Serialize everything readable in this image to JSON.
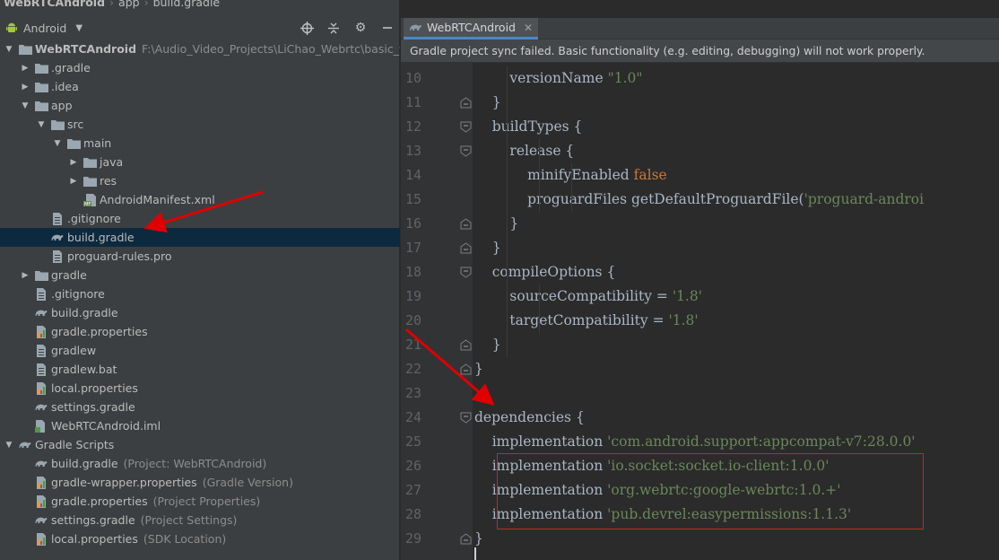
{
  "breadcrumb": [
    "WebRTCAndroid",
    "app",
    "build.gradle"
  ],
  "project_toolbar": {
    "view_label": "Android",
    "icons": [
      "locate-icon",
      "collapse-all-icon",
      "gear-icon",
      "minimize-icon"
    ]
  },
  "tree": [
    {
      "indent": 0,
      "arrow": "down",
      "icon": "project-folder",
      "label": "WebRTCAndroid",
      "bold": true,
      "hint": "F:\\Audio_Video_Projects\\LiChao_Webrtc\\basic_webrt"
    },
    {
      "indent": 1,
      "arrow": "right",
      "icon": "folder",
      "label": ".gradle"
    },
    {
      "indent": 1,
      "arrow": "right",
      "icon": "folder",
      "label": ".idea"
    },
    {
      "indent": 1,
      "arrow": "down",
      "icon": "folder",
      "label": "app"
    },
    {
      "indent": 2,
      "arrow": "down",
      "icon": "folder",
      "label": "src"
    },
    {
      "indent": 3,
      "arrow": "down",
      "icon": "folder",
      "label": "main"
    },
    {
      "indent": 4,
      "arrow": "right",
      "icon": "folder",
      "label": "java"
    },
    {
      "indent": 4,
      "arrow": "right",
      "icon": "folder",
      "label": "res"
    },
    {
      "indent": 4,
      "arrow": "none",
      "icon": "manifest",
      "label": "AndroidManifest.xml"
    },
    {
      "indent": 2,
      "arrow": "none",
      "icon": "file",
      "label": ".gitignore"
    },
    {
      "indent": 2,
      "arrow": "none",
      "icon": "gradle",
      "label": "build.gradle",
      "selected": true
    },
    {
      "indent": 2,
      "arrow": "none",
      "icon": "file",
      "label": "proguard-rules.pro"
    },
    {
      "indent": 1,
      "arrow": "right",
      "icon": "folder",
      "label": "gradle"
    },
    {
      "indent": 1,
      "arrow": "none",
      "icon": "file",
      "label": ".gitignore"
    },
    {
      "indent": 1,
      "arrow": "none",
      "icon": "gradle",
      "label": "build.gradle"
    },
    {
      "indent": 1,
      "arrow": "none",
      "icon": "properties",
      "label": "gradle.properties"
    },
    {
      "indent": 1,
      "arrow": "none",
      "icon": "file",
      "label": "gradlew"
    },
    {
      "indent": 1,
      "arrow": "none",
      "icon": "file",
      "label": "gradlew.bat"
    },
    {
      "indent": 1,
      "arrow": "none",
      "icon": "properties",
      "label": "local.properties"
    },
    {
      "indent": 1,
      "arrow": "none",
      "icon": "gradle",
      "label": "settings.gradle"
    },
    {
      "indent": 1,
      "arrow": "none",
      "icon": "iml",
      "label": "WebRTCAndroid.iml"
    },
    {
      "indent": 0,
      "arrow": "down",
      "icon": "gradle",
      "label": "Gradle Scripts"
    },
    {
      "indent": 1,
      "arrow": "none",
      "icon": "gradle",
      "label": "build.gradle",
      "hint": "(Project: WebRTCAndroid)"
    },
    {
      "indent": 1,
      "arrow": "none",
      "icon": "properties",
      "label": "gradle-wrapper.properties",
      "hint": "(Gradle Version)"
    },
    {
      "indent": 1,
      "arrow": "none",
      "icon": "properties",
      "label": "gradle.properties",
      "hint": "(Project Properties)"
    },
    {
      "indent": 1,
      "arrow": "none",
      "icon": "gradle",
      "label": "settings.gradle",
      "hint": "(Project Settings)"
    },
    {
      "indent": 1,
      "arrow": "none",
      "icon": "properties",
      "label": "local.properties",
      "hint": "(SDK Location)"
    }
  ],
  "editor": {
    "tab_label": "WebRTCAndroid",
    "sync_message": "Gradle project sync failed. Basic functionality (e.g. editing, debugging) will not work properly.",
    "lines": [
      {
        "num": "10",
        "fold": "none",
        "segs": [
          [
            "        versionName ",
            "p"
          ],
          [
            "\"1.0\"",
            "s"
          ]
        ]
      },
      {
        "num": "11",
        "fold": "end",
        "segs": [
          [
            "    }",
            "p"
          ]
        ]
      },
      {
        "num": "12",
        "fold": "start",
        "segs": [
          [
            "    buildTypes {",
            "p"
          ]
        ]
      },
      {
        "num": "13",
        "fold": "start",
        "segs": [
          [
            "        release {",
            "p"
          ]
        ]
      },
      {
        "num": "14",
        "fold": "none",
        "segs": [
          [
            "            minifyEnabled ",
            "p"
          ],
          [
            "false",
            "k"
          ]
        ]
      },
      {
        "num": "15",
        "fold": "none",
        "segs": [
          [
            "            proguardFiles getDefaultProguardFile(",
            "p"
          ],
          [
            "'proguard-androi",
            "s"
          ]
        ]
      },
      {
        "num": "16",
        "fold": "end",
        "segs": [
          [
            "        }",
            "p"
          ]
        ]
      },
      {
        "num": "17",
        "fold": "end",
        "segs": [
          [
            "    }",
            "p"
          ]
        ]
      },
      {
        "num": "18",
        "fold": "start",
        "segs": [
          [
            "    compileOptions {",
            "p"
          ]
        ]
      },
      {
        "num": "19",
        "fold": "none",
        "segs": [
          [
            "        sourceCompatibility = ",
            "p"
          ],
          [
            "'1.8'",
            "s"
          ]
        ]
      },
      {
        "num": "20",
        "fold": "none",
        "segs": [
          [
            "        targetCompatibility = ",
            "p"
          ],
          [
            "'1.8'",
            "s"
          ]
        ]
      },
      {
        "num": "21",
        "fold": "end",
        "segs": [
          [
            "    }",
            "p"
          ]
        ]
      },
      {
        "num": "22",
        "fold": "end",
        "segs": [
          [
            "}",
            "p"
          ]
        ]
      },
      {
        "num": "23",
        "fold": "none",
        "segs": []
      },
      {
        "num": "24",
        "fold": "start",
        "segs": [
          [
            "dependencies {",
            "p"
          ]
        ]
      },
      {
        "num": "25",
        "fold": "none",
        "segs": [
          [
            "    implementation ",
            "p"
          ],
          [
            "'com.android.support:appcompat-v7:28.0.0'",
            "s"
          ]
        ]
      },
      {
        "num": "26",
        "fold": "none",
        "segs": [
          [
            "    implementation ",
            "p"
          ],
          [
            "'io.socket:socket.io-client:1.0.0'",
            "s"
          ]
        ]
      },
      {
        "num": "27",
        "fold": "none",
        "segs": [
          [
            "    implementation ",
            "p"
          ],
          [
            "'org.webrtc:google-webrtc:1.0.+'",
            "s"
          ]
        ]
      },
      {
        "num": "28",
        "fold": "none",
        "segs": [
          [
            "    implementation ",
            "p"
          ],
          [
            "'pub.devrel:easypermissions:1.1.3'",
            "s"
          ]
        ]
      },
      {
        "num": "29",
        "fold": "end",
        "segs": [
          [
            "}",
            "p"
          ]
        ]
      },
      {
        "num": "",
        "fold": "none",
        "segs": []
      }
    ]
  },
  "colors": {
    "accent_red": "#d02222",
    "selection": "#0d293e",
    "string": "#6a8759",
    "keyword": "#cc7832"
  }
}
